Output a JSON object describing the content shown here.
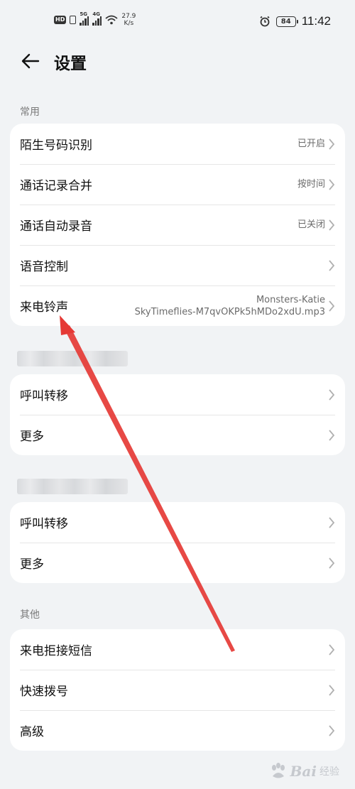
{
  "status_bar": {
    "net_speed_value": "27.9",
    "net_speed_unit": "K/s",
    "sig1": "5G",
    "sig2": "4G",
    "battery": "84",
    "time": "11:42"
  },
  "header": {
    "title": "设置"
  },
  "sections": {
    "common": {
      "title": "常用",
      "items": [
        {
          "label": "陌生号码识别",
          "value": "已开启"
        },
        {
          "label": "通话记录合并",
          "value": "按时间"
        },
        {
          "label": "通话自动录音",
          "value": "已关闭"
        },
        {
          "label": "语音控制",
          "value": ""
        },
        {
          "label": "来电铃声",
          "value_line1": "Monsters-Katie",
          "value_line2": "SkyTimeflies-M7qvOKPk5hMDo2xdU.mp3"
        }
      ]
    },
    "sim1": {
      "items": [
        {
          "label": "呼叫转移"
        },
        {
          "label": "更多"
        }
      ]
    },
    "sim2": {
      "items": [
        {
          "label": "呼叫转移"
        },
        {
          "label": "更多"
        }
      ]
    },
    "other": {
      "title": "其他",
      "items": [
        {
          "label": "来电拒接短信"
        },
        {
          "label": "快速拨号"
        },
        {
          "label": "高级"
        }
      ]
    }
  },
  "watermark": {
    "brand": "Bai",
    "sub": "经验"
  },
  "colors": {
    "background": "#f1f3f5",
    "card": "#ffffff",
    "annotation_arrow": "#e53935"
  }
}
